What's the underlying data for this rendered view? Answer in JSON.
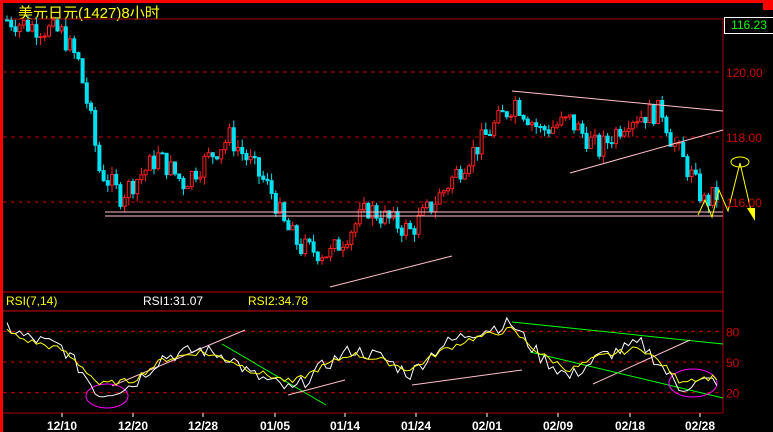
{
  "title": "美元日元(1427)8小时",
  "last_price": "116.23",
  "rsi": {
    "label": "RSI(7,14)",
    "rsi1": "RSI1:31.07",
    "rsi2": "RSI2:34.78"
  },
  "colors": {
    "up": "#ff2020",
    "down": "#00e0f0",
    "rsi1": "#ffffff",
    "rsi2": "#ffff00",
    "grid": "#c00000"
  },
  "chart_data": {
    "type": "candlestick",
    "title": "美元日元(1427)8小时",
    "price_ticks": [
      "120.00",
      "118.00",
      "116.00"
    ],
    "price_tick_values": [
      120,
      118,
      116
    ],
    "ylim": [
      113.8,
      121.8
    ],
    "bars": 170,
    "price_waypoints": [
      [
        0,
        121.6
      ],
      [
        13,
        121.2
      ],
      [
        17,
        120.3
      ],
      [
        20,
        118.5
      ],
      [
        22,
        117
      ],
      [
        27,
        116.2
      ],
      [
        36,
        117.4
      ],
      [
        42,
        116.6
      ],
      [
        53,
        118
      ],
      [
        58,
        117.2
      ],
      [
        63,
        116.3
      ],
      [
        66,
        115.3
      ],
      [
        70,
        114.6
      ],
      [
        77,
        114.4
      ],
      [
        86,
        115.8
      ],
      [
        96,
        115.1
      ],
      [
        103,
        116.2
      ],
      [
        110,
        117.4
      ],
      [
        117,
        118.5
      ],
      [
        121,
        119.1
      ],
      [
        127,
        118.2
      ],
      [
        134,
        118.5
      ],
      [
        141,
        117.6
      ],
      [
        148,
        118.6
      ],
      [
        156,
        118.8
      ],
      [
        158,
        118
      ],
      [
        163,
        116.8
      ],
      [
        166,
        116.0
      ],
      [
        169,
        116.2
      ]
    ],
    "rsi_ticks": [
      "80",
      "50",
      "20"
    ],
    "rsi_tick_values": [
      80,
      50,
      20
    ],
    "rsi1_waypoints": [
      [
        0,
        85
      ],
      [
        4,
        75
      ],
      [
        13,
        65
      ],
      [
        18,
        40
      ],
      [
        22,
        18
      ],
      [
        30,
        28
      ],
      [
        37,
        55
      ],
      [
        46,
        62
      ],
      [
        53,
        55
      ],
      [
        58,
        38
      ],
      [
        68,
        22
      ],
      [
        75,
        45
      ],
      [
        82,
        62
      ],
      [
        89,
        55
      ],
      [
        96,
        38
      ],
      [
        103,
        65
      ],
      [
        110,
        78
      ],
      [
        120,
        88
      ],
      [
        127,
        55
      ],
      [
        134,
        35
      ],
      [
        141,
        55
      ],
      [
        151,
        68
      ],
      [
        156,
        45
      ],
      [
        160,
        25
      ],
      [
        165,
        30
      ],
      [
        169,
        32
      ]
    ],
    "rsi2_waypoints": [
      [
        0,
        80
      ],
      [
        4,
        72
      ],
      [
        13,
        62
      ],
      [
        18,
        45
      ],
      [
        22,
        28
      ],
      [
        30,
        32
      ],
      [
        37,
        52
      ],
      [
        46,
        60
      ],
      [
        53,
        52
      ],
      [
        58,
        42
      ],
      [
        68,
        30
      ],
      [
        75,
        45
      ],
      [
        82,
        58
      ],
      [
        89,
        52
      ],
      [
        96,
        42
      ],
      [
        103,
        60
      ],
      [
        110,
        72
      ],
      [
        120,
        82
      ],
      [
        127,
        58
      ],
      [
        134,
        42
      ],
      [
        141,
        55
      ],
      [
        151,
        64
      ],
      [
        156,
        48
      ],
      [
        160,
        32
      ],
      [
        165,
        34
      ],
      [
        169,
        35
      ]
    ],
    "x_tick_labels": [
      "12/10",
      "12/20",
      "12/28",
      "01/05",
      "01/14",
      "01/24",
      "02/01",
      "02/09",
      "02/18",
      "02/28"
    ]
  }
}
